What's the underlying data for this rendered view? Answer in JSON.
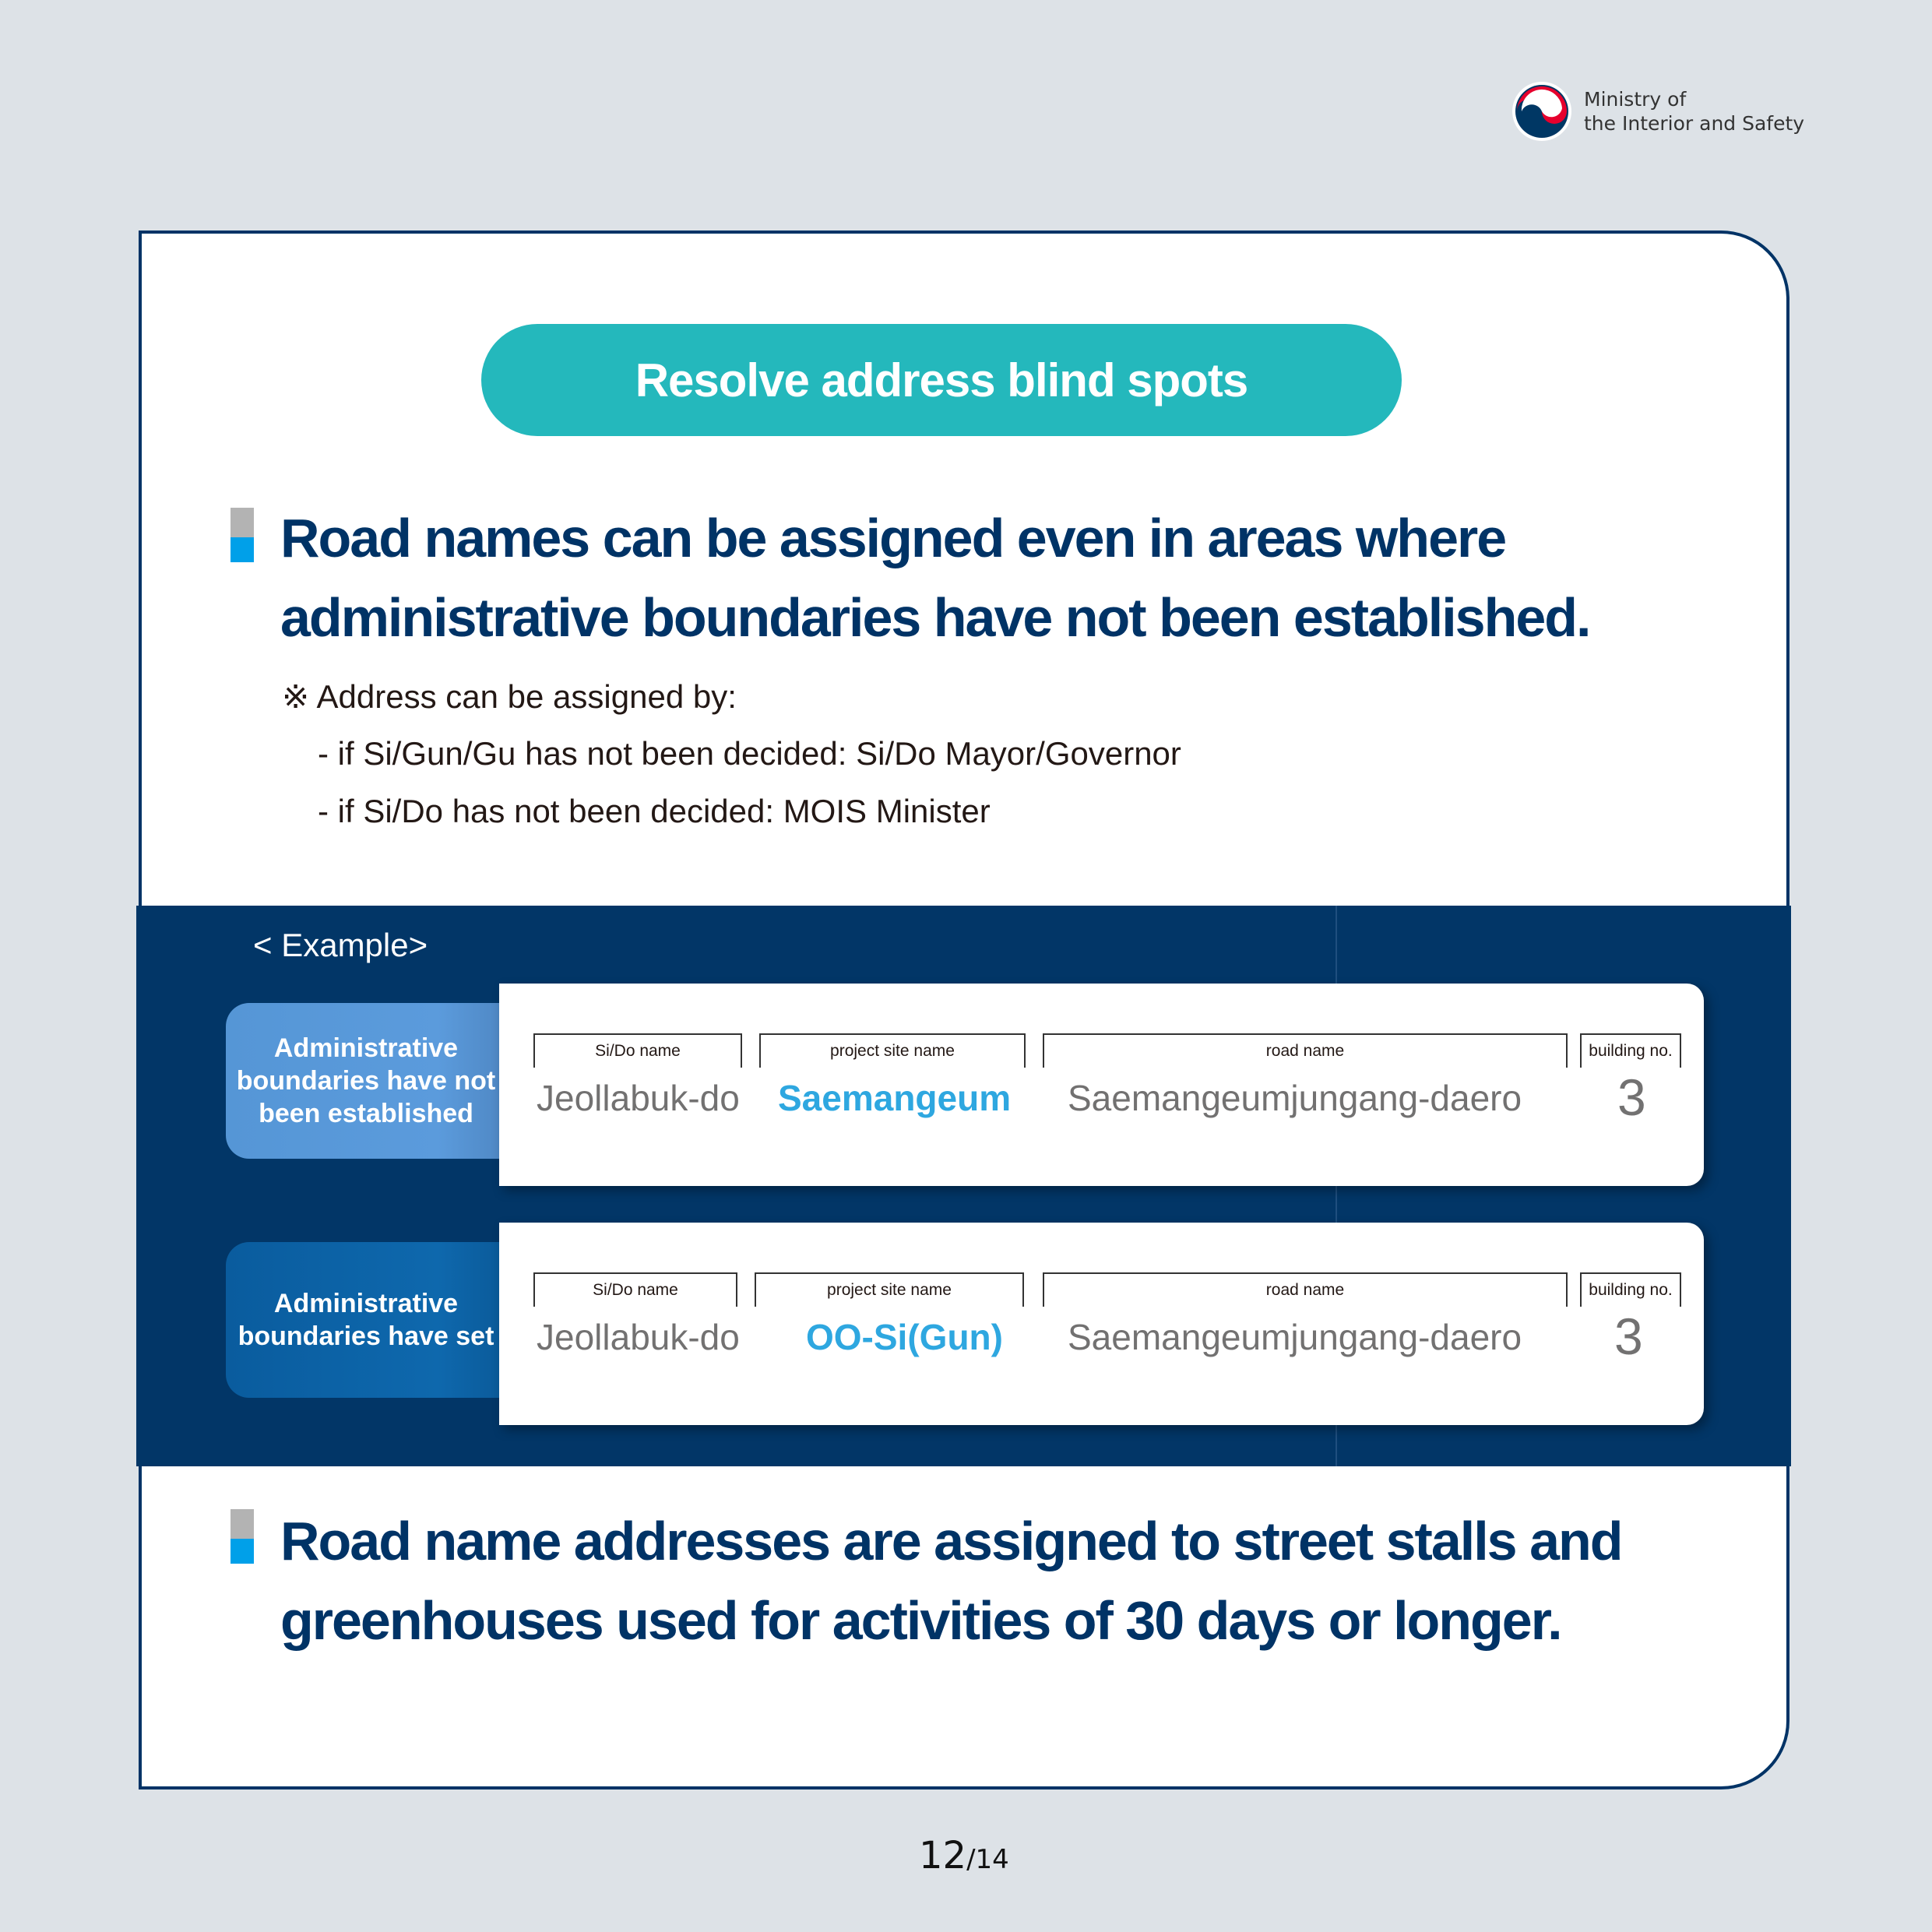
{
  "header": {
    "logo_icon": "taegeuk-emblem-icon",
    "ministry_line1": "Ministry of",
    "ministry_line2": "the Interior and Safety"
  },
  "title": "Resolve address blind spots",
  "section1": {
    "heading_line1": "Road names can be assigned even in areas where",
    "heading_line2": "administrative boundaries have not been established.",
    "note": "※ Address can be assigned by:",
    "items": [
      "-  if Si/Gun/Gu has not been decided: Si/Do Mayor/Governor",
      "-  if Si/Do has not been decided: MOIS Minister"
    ]
  },
  "example": {
    "title": "< Example>",
    "rows": [
      {
        "label": "Administrative boundaries have not been established",
        "fields": [
          {
            "header": "Si/Do name",
            "value": "Jeollabuk-do"
          },
          {
            "header": "project site name",
            "value": "Saemangeum"
          },
          {
            "header": "road name",
            "value": "Saemangeumjungang-daero"
          },
          {
            "header": "building no.",
            "value": "3"
          }
        ]
      },
      {
        "label": "Administrative boundaries have set",
        "fields": [
          {
            "header": "Si/Do name",
            "value": "Jeollabuk-do"
          },
          {
            "header": "project site name",
            "value": "OO-Si(Gun)"
          },
          {
            "header": "road name",
            "value": "Saemangeumjungang-daero"
          },
          {
            "header": "building no.",
            "value": "3"
          }
        ]
      }
    ]
  },
  "section2": {
    "heading_line1": "Road name addresses are assigned to street stalls and",
    "heading_line2": "greenhouses used for activities of 30 days or longer."
  },
  "pager": {
    "current": "12",
    "separator": "/",
    "total": "14"
  },
  "colors": {
    "navy": "#003366",
    "teal": "#24b8bc",
    "highlight": "#2ea7e0",
    "bullet_blue": "#00a0e9",
    "bullet_gray": "#b3b3b3"
  }
}
